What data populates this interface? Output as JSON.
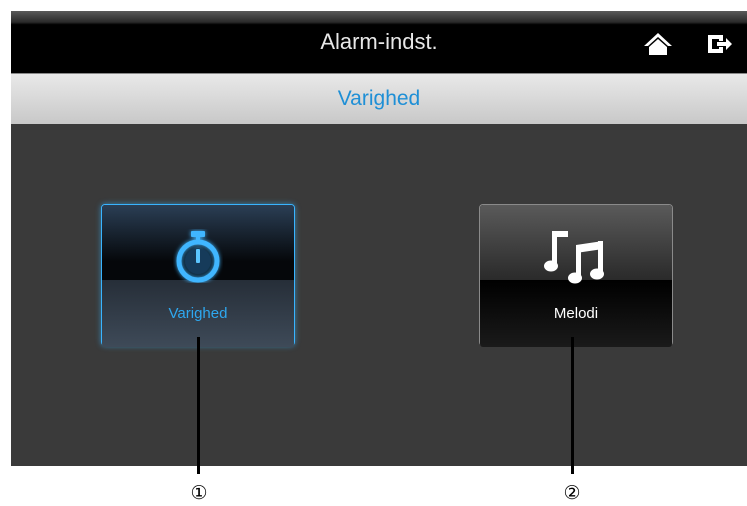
{
  "header": {
    "title": "Alarm-indst.",
    "home_icon": "home-icon",
    "exit_icon": "exit-icon"
  },
  "subheader": {
    "title": "Varighed"
  },
  "tiles": [
    {
      "label": "Varighed",
      "icon": "stopwatch-icon",
      "selected": true,
      "accent": "#2ea8f0"
    },
    {
      "label": "Melodi",
      "icon": "music-notes-icon",
      "selected": false
    }
  ],
  "callouts": [
    "①",
    "②"
  ],
  "colors": {
    "accent": "#1e8fd6",
    "background": "#3a3a3a"
  }
}
